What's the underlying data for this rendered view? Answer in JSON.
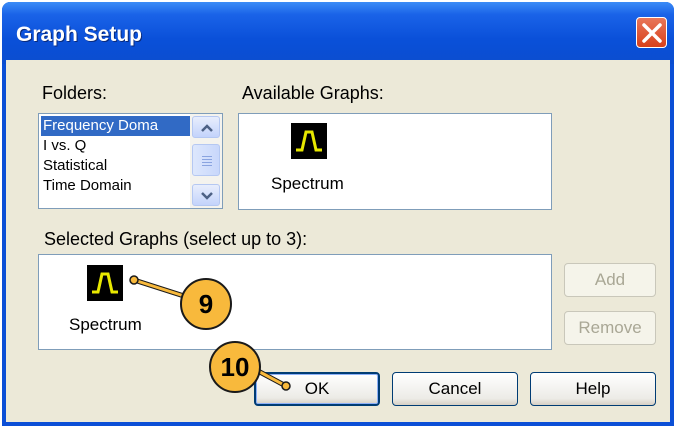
{
  "window": {
    "title": "Graph Setup"
  },
  "folders": {
    "label": "Folders:",
    "items": [
      {
        "label": "Frequency Doma",
        "selected": true
      },
      {
        "label": "I vs. Q",
        "selected": false
      },
      {
        "label": "Statistical",
        "selected": false
      },
      {
        "label": "Time Domain",
        "selected": false
      }
    ]
  },
  "available": {
    "label": "Available Graphs:",
    "graphs": [
      {
        "label": "Spectrum"
      }
    ]
  },
  "selected": {
    "label": "Selected Graphs (select up to 3):",
    "graphs": [
      {
        "label": "Spectrum"
      }
    ]
  },
  "buttons": {
    "add": "Add",
    "remove": "Remove",
    "ok": "OK",
    "cancel": "Cancel",
    "help": "Help"
  },
  "callouts": [
    "9",
    "10"
  ],
  "colors": {
    "titlebar": "#0a50d9",
    "selection": "#316ac5",
    "callout": "#f8b93c",
    "icon_trace": "#e8e800"
  }
}
